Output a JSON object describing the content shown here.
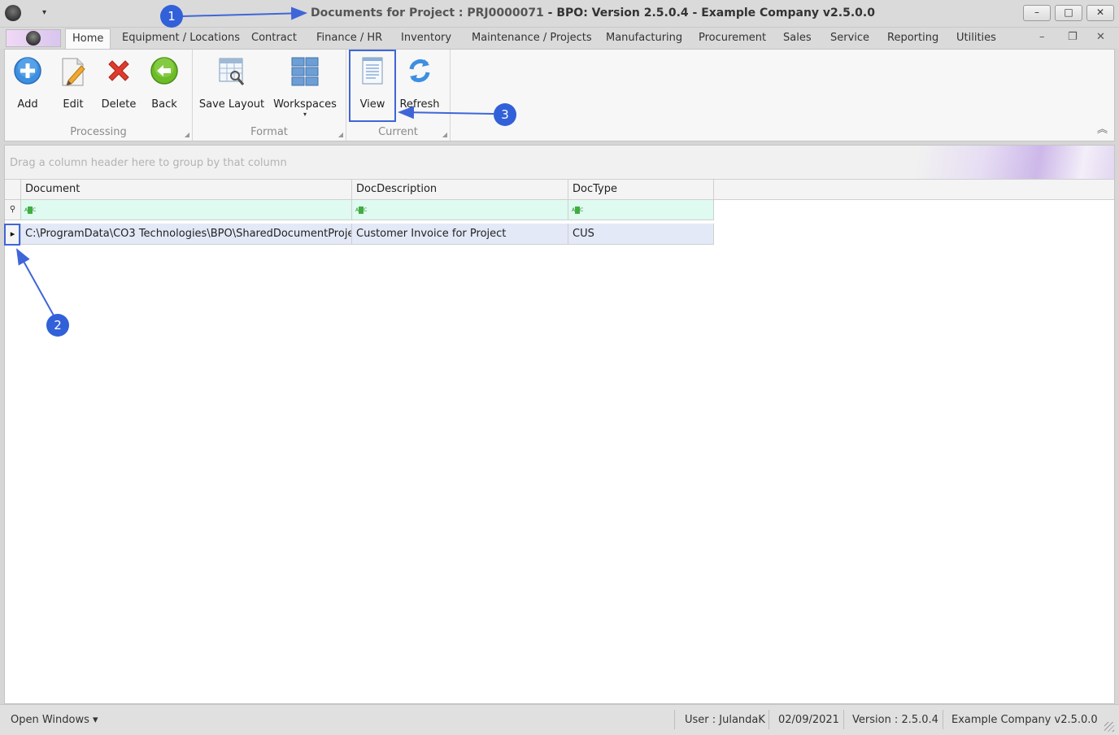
{
  "window": {
    "title_prefix": "Documents for Project : PRJ0000071",
    "title_rest": " - BPO: Version 2.5.0.4 - Example Company v2.5.0.0",
    "minimize": "–",
    "maximize": "□",
    "close": "✕",
    "qa_caret": "▾"
  },
  "tabs": [
    {
      "label": "Home"
    },
    {
      "label": "Equipment / Locations"
    },
    {
      "label": "Contract"
    },
    {
      "label": "Finance / HR"
    },
    {
      "label": "Inventory"
    },
    {
      "label": "Maintenance / Projects"
    },
    {
      "label": "Manufacturing"
    },
    {
      "label": "Procurement"
    },
    {
      "label": "Sales"
    },
    {
      "label": "Service"
    },
    {
      "label": "Reporting"
    },
    {
      "label": "Utilities"
    }
  ],
  "mdi": {
    "minimize": "–",
    "restore": "❐",
    "close": "✕"
  },
  "ribbon": {
    "processing": {
      "label": "Processing",
      "add": "Add",
      "edit": "Edit",
      "delete": "Delete",
      "back": "Back"
    },
    "format": {
      "label": "Format",
      "save_layout": "Save Layout",
      "workspaces": "Workspaces",
      "workspaces_dd": "▾"
    },
    "current": {
      "label": "Current",
      "view": "View",
      "refresh": "Refresh"
    },
    "collapse": "︽",
    "launcher": "◢"
  },
  "grid": {
    "group_panel_hint": "Drag a column header here to group by that column",
    "columns": [
      "Document",
      "DocDescription",
      "DocType"
    ],
    "filter_icon_text": "A",
    "filter_icon_text2": "C",
    "filter_pin": "⚲",
    "row_indicator": "▸",
    "rows": [
      {
        "document": "C:\\ProgramData\\CO3 Technologies\\BPO\\SharedDocumentProje...",
        "description": "Customer Invoice for Project",
        "doctype": "CUS"
      }
    ]
  },
  "status": {
    "open_windows": "Open Windows ▾",
    "user": "User : JulandaK",
    "date": "02/09/2021",
    "version": "Version : 2.5.0.4",
    "company": "Example Company v2.5.0.0"
  },
  "callouts": [
    "1",
    "2",
    "3"
  ],
  "colors": {
    "callout": "#3160d9",
    "highlight": "#3f66d8"
  }
}
